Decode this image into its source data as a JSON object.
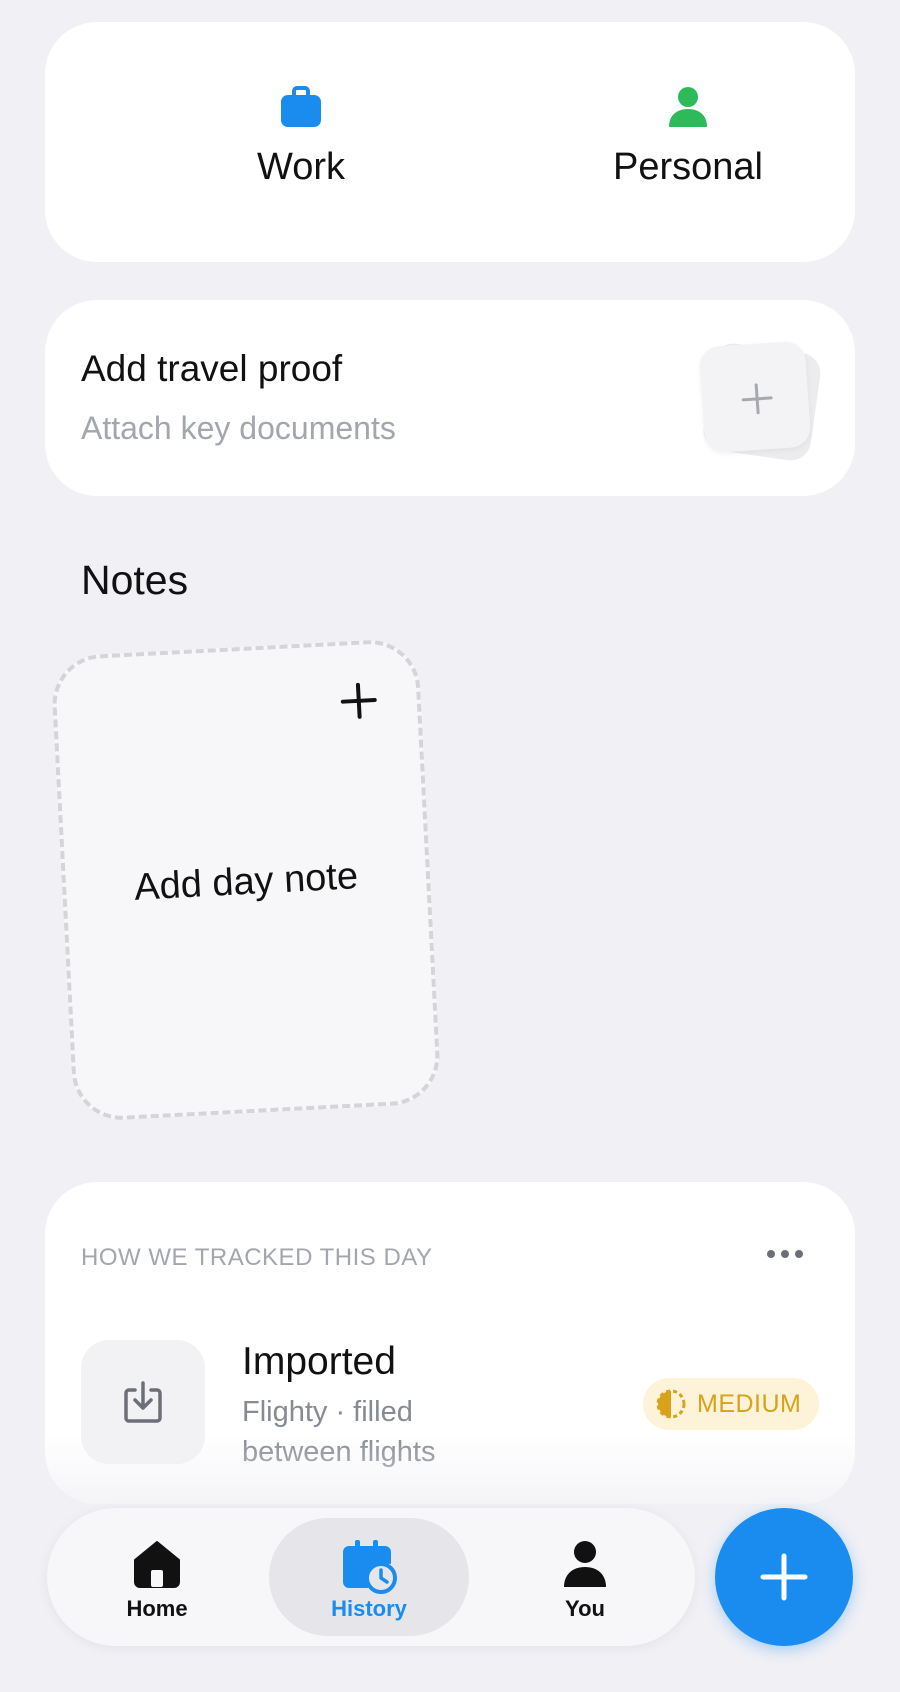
{
  "categories": [
    {
      "label": "Work",
      "icon": "briefcase-icon",
      "color": "#1a8cf0"
    },
    {
      "label": "Personal",
      "icon": "person-icon",
      "color": "#2dbb5a"
    }
  ],
  "travel_proof": {
    "title": "Add travel proof",
    "subtitle": "Attach key documents",
    "icon": "plus-icon"
  },
  "notes": {
    "heading": "Notes",
    "add_label": "Add day note",
    "icon": "plus-icon"
  },
  "tracking": {
    "heading": "HOW WE TRACKED THIS DAY",
    "method_title": "Imported",
    "method_subtitle": "Flighty · filled between flights",
    "confidence": "MEDIUM",
    "confidence_color": "#d8a21a",
    "icon": "download-icon"
  },
  "nav": {
    "items": [
      {
        "label": "Home",
        "icon": "house-icon"
      },
      {
        "label": "History",
        "icon": "calendar-clock-icon",
        "active": true
      },
      {
        "label": "You",
        "icon": "person-icon"
      }
    ],
    "active_color": "#1a8cf0"
  },
  "fab": {
    "icon": "plus-icon",
    "color": "#1a8cf0"
  }
}
